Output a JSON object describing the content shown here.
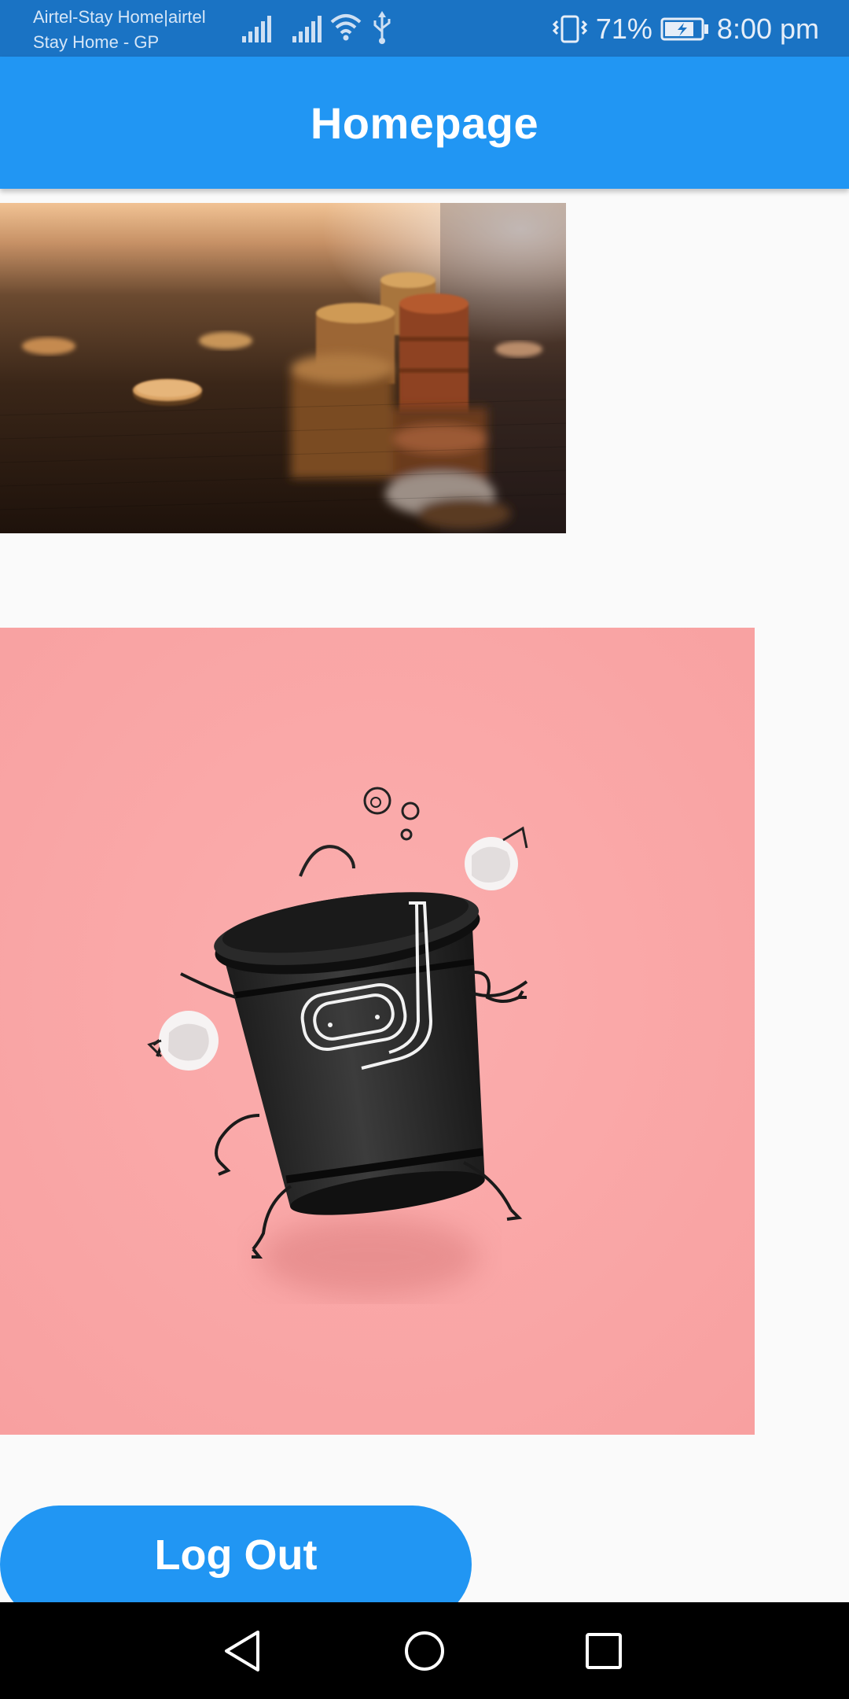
{
  "status_bar": {
    "carrier_line1": "Airtel-Stay Home|airtel",
    "carrier_line2": "Stay Home - GP",
    "battery_percent": "71%",
    "time": "8:00 pm",
    "icons": [
      "signal-icon",
      "signal-icon",
      "wifi-icon",
      "usb-icon",
      "vibrate-icon",
      "battery-charging-icon"
    ]
  },
  "app_bar": {
    "title": "Homepage",
    "color": "#2196f3"
  },
  "images": [
    {
      "name": "coins-photo"
    },
    {
      "name": "trash-bin-illustration"
    }
  ],
  "logout": {
    "label": "Log Out"
  },
  "nav_bar": {
    "icons": [
      "back-icon",
      "home-icon",
      "recents-icon"
    ]
  }
}
